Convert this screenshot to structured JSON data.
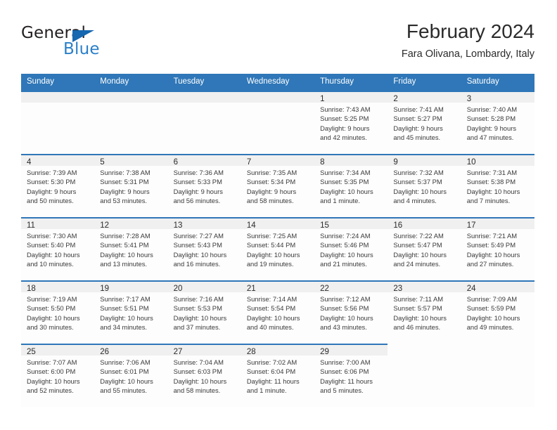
{
  "brand": {
    "name_part1": "General",
    "name_part2": "Blue",
    "flag_icon": "triangle-flag-icon",
    "accent_color": "#2a7fc9"
  },
  "header": {
    "title": "February 2024",
    "subtitle": "Fara Olivana, Lombardy, Italy"
  },
  "calendar": {
    "header_bg": "#2f77b8",
    "daynum_bg": "#f0f0f0",
    "weekdays": [
      "Sunday",
      "Monday",
      "Tuesday",
      "Wednesday",
      "Thursday",
      "Friday",
      "Saturday"
    ],
    "weeks": [
      [
        {
          "day": "",
          "type": "blank"
        },
        {
          "day": "",
          "type": "blank"
        },
        {
          "day": "",
          "type": "blank"
        },
        {
          "day": "",
          "type": "blank"
        },
        {
          "day": "1",
          "type": "filled",
          "sunrise": "Sunrise: 7:43 AM",
          "sunset": "Sunset: 5:25 PM",
          "daylight1": "Daylight: 9 hours",
          "daylight2": "and 42 minutes."
        },
        {
          "day": "2",
          "type": "filled",
          "sunrise": "Sunrise: 7:41 AM",
          "sunset": "Sunset: 5:27 PM",
          "daylight1": "Daylight: 9 hours",
          "daylight2": "and 45 minutes."
        },
        {
          "day": "3",
          "type": "filled",
          "sunrise": "Sunrise: 7:40 AM",
          "sunset": "Sunset: 5:28 PM",
          "daylight1": "Daylight: 9 hours",
          "daylight2": "and 47 minutes."
        }
      ],
      [
        {
          "day": "4",
          "type": "filled",
          "sunrise": "Sunrise: 7:39 AM",
          "sunset": "Sunset: 5:30 PM",
          "daylight1": "Daylight: 9 hours",
          "daylight2": "and 50 minutes."
        },
        {
          "day": "5",
          "type": "filled",
          "sunrise": "Sunrise: 7:38 AM",
          "sunset": "Sunset: 5:31 PM",
          "daylight1": "Daylight: 9 hours",
          "daylight2": "and 53 minutes."
        },
        {
          "day": "6",
          "type": "filled",
          "sunrise": "Sunrise: 7:36 AM",
          "sunset": "Sunset: 5:33 PM",
          "daylight1": "Daylight: 9 hours",
          "daylight2": "and 56 minutes."
        },
        {
          "day": "7",
          "type": "filled",
          "sunrise": "Sunrise: 7:35 AM",
          "sunset": "Sunset: 5:34 PM",
          "daylight1": "Daylight: 9 hours",
          "daylight2": "and 58 minutes."
        },
        {
          "day": "8",
          "type": "filled",
          "sunrise": "Sunrise: 7:34 AM",
          "sunset": "Sunset: 5:35 PM",
          "daylight1": "Daylight: 10 hours",
          "daylight2": "and 1 minute."
        },
        {
          "day": "9",
          "type": "filled",
          "sunrise": "Sunrise: 7:32 AM",
          "sunset": "Sunset: 5:37 PM",
          "daylight1": "Daylight: 10 hours",
          "daylight2": "and 4 minutes."
        },
        {
          "day": "10",
          "type": "filled",
          "sunrise": "Sunrise: 7:31 AM",
          "sunset": "Sunset: 5:38 PM",
          "daylight1": "Daylight: 10 hours",
          "daylight2": "and 7 minutes."
        }
      ],
      [
        {
          "day": "11",
          "type": "filled",
          "sunrise": "Sunrise: 7:30 AM",
          "sunset": "Sunset: 5:40 PM",
          "daylight1": "Daylight: 10 hours",
          "daylight2": "and 10 minutes."
        },
        {
          "day": "12",
          "type": "filled",
          "sunrise": "Sunrise: 7:28 AM",
          "sunset": "Sunset: 5:41 PM",
          "daylight1": "Daylight: 10 hours",
          "daylight2": "and 13 minutes."
        },
        {
          "day": "13",
          "type": "filled",
          "sunrise": "Sunrise: 7:27 AM",
          "sunset": "Sunset: 5:43 PM",
          "daylight1": "Daylight: 10 hours",
          "daylight2": "and 16 minutes."
        },
        {
          "day": "14",
          "type": "filled",
          "sunrise": "Sunrise: 7:25 AM",
          "sunset": "Sunset: 5:44 PM",
          "daylight1": "Daylight: 10 hours",
          "daylight2": "and 19 minutes."
        },
        {
          "day": "15",
          "type": "filled",
          "sunrise": "Sunrise: 7:24 AM",
          "sunset": "Sunset: 5:46 PM",
          "daylight1": "Daylight: 10 hours",
          "daylight2": "and 21 minutes."
        },
        {
          "day": "16",
          "type": "filled",
          "sunrise": "Sunrise: 7:22 AM",
          "sunset": "Sunset: 5:47 PM",
          "daylight1": "Daylight: 10 hours",
          "daylight2": "and 24 minutes."
        },
        {
          "day": "17",
          "type": "filled",
          "sunrise": "Sunrise: 7:21 AM",
          "sunset": "Sunset: 5:49 PM",
          "daylight1": "Daylight: 10 hours",
          "daylight2": "and 27 minutes."
        }
      ],
      [
        {
          "day": "18",
          "type": "filled",
          "sunrise": "Sunrise: 7:19 AM",
          "sunset": "Sunset: 5:50 PM",
          "daylight1": "Daylight: 10 hours",
          "daylight2": "and 30 minutes."
        },
        {
          "day": "19",
          "type": "filled",
          "sunrise": "Sunrise: 7:17 AM",
          "sunset": "Sunset: 5:51 PM",
          "daylight1": "Daylight: 10 hours",
          "daylight2": "and 34 minutes."
        },
        {
          "day": "20",
          "type": "filled",
          "sunrise": "Sunrise: 7:16 AM",
          "sunset": "Sunset: 5:53 PM",
          "daylight1": "Daylight: 10 hours",
          "daylight2": "and 37 minutes."
        },
        {
          "day": "21",
          "type": "filled",
          "sunrise": "Sunrise: 7:14 AM",
          "sunset": "Sunset: 5:54 PM",
          "daylight1": "Daylight: 10 hours",
          "daylight2": "and 40 minutes."
        },
        {
          "day": "22",
          "type": "filled",
          "sunrise": "Sunrise: 7:12 AM",
          "sunset": "Sunset: 5:56 PM",
          "daylight1": "Daylight: 10 hours",
          "daylight2": "and 43 minutes."
        },
        {
          "day": "23",
          "type": "filled",
          "sunrise": "Sunrise: 7:11 AM",
          "sunset": "Sunset: 5:57 PM",
          "daylight1": "Daylight: 10 hours",
          "daylight2": "and 46 minutes."
        },
        {
          "day": "24",
          "type": "filled",
          "sunrise": "Sunrise: 7:09 AM",
          "sunset": "Sunset: 5:59 PM",
          "daylight1": "Daylight: 10 hours",
          "daylight2": "and 49 minutes."
        }
      ],
      [
        {
          "day": "25",
          "type": "filled",
          "sunrise": "Sunrise: 7:07 AM",
          "sunset": "Sunset: 6:00 PM",
          "daylight1": "Daylight: 10 hours",
          "daylight2": "and 52 minutes."
        },
        {
          "day": "26",
          "type": "filled",
          "sunrise": "Sunrise: 7:06 AM",
          "sunset": "Sunset: 6:01 PM",
          "daylight1": "Daylight: 10 hours",
          "daylight2": "and 55 minutes."
        },
        {
          "day": "27",
          "type": "filled",
          "sunrise": "Sunrise: 7:04 AM",
          "sunset": "Sunset: 6:03 PM",
          "daylight1": "Daylight: 10 hours",
          "daylight2": "and 58 minutes."
        },
        {
          "day": "28",
          "type": "filled",
          "sunrise": "Sunrise: 7:02 AM",
          "sunset": "Sunset: 6:04 PM",
          "daylight1": "Daylight: 11 hours",
          "daylight2": "and 1 minute."
        },
        {
          "day": "29",
          "type": "filled",
          "sunrise": "Sunrise: 7:00 AM",
          "sunset": "Sunset: 6:06 PM",
          "daylight1": "Daylight: 11 hours",
          "daylight2": "and 5 minutes."
        },
        {
          "day": "",
          "type": "empty"
        },
        {
          "day": "",
          "type": "empty"
        }
      ]
    ]
  }
}
